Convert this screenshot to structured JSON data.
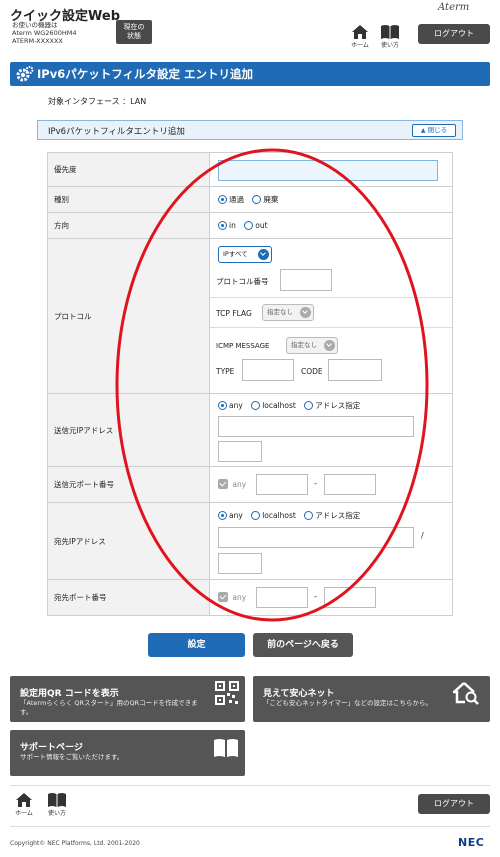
{
  "header": {
    "title": "クイック設定Web",
    "device_lines": [
      "お使いの機器は",
      "Aterm WG2600HM4",
      "ATERM-XXXXXX"
    ],
    "status_btn": [
      "現在の",
      "状態"
    ],
    "home_label": "ホーム",
    "howto_label": "使い方",
    "logout_label": "ログアウト",
    "brand": "Aterm"
  },
  "page_title": "IPv6パケットフィルタ設定 エントリ追加",
  "interface_label": "対象インタフェース ：LAN",
  "section": {
    "title": "IPv6パケットフィルタエントリ追加",
    "close_label": "閉じる"
  },
  "form": {
    "priority": {
      "label": "優先度",
      "value": ""
    },
    "type": {
      "label": "種別",
      "options": [
        "通過",
        "廃棄"
      ],
      "selected": "通過"
    },
    "direction": {
      "label": "方向",
      "options": [
        "in",
        "out"
      ],
      "selected": "in"
    },
    "protocol": {
      "label": "プロトコル",
      "select_value": "IPすべて",
      "number_label": "プロトコル番号",
      "tcp_flag_label": "TCP FLAG",
      "tcp_flag_value": "指定なし",
      "icmp_label": "ICMP MESSAGE",
      "icmp_value": "指定なし",
      "type_label": "TYPE",
      "code_label": "CODE"
    },
    "src_ip": {
      "label": "送信元IPアドレス",
      "options": [
        "any",
        "localhost",
        "アドレス指定"
      ],
      "selected": "any"
    },
    "src_port": {
      "label": "送信元ポート番号",
      "any_label": "any",
      "dash": "-"
    },
    "dst_ip": {
      "label": "宛先IPアドレス",
      "options": [
        "any",
        "localhost",
        "アドレス指定"
      ],
      "selected": "any",
      "slash": "/"
    },
    "dst_port": {
      "label": "宛先ポート番号",
      "any_label": "any",
      "dash": "-"
    }
  },
  "buttons": {
    "submit": "設定",
    "back": "前のページへ戻る"
  },
  "tiles": {
    "qr": {
      "title": "設定用QR コードを表示",
      "desc": [
        "「Atermらくらく QRスタート」用のQRコードを作成できま",
        "す。"
      ]
    },
    "safe": {
      "title": "見えて安心ネット",
      "desc": [
        "「こども安心ネットタイマー」などの設定はこちらから。"
      ]
    },
    "support": {
      "title": "サポートページ",
      "desc": [
        "サポート情報をご覧いただけます。"
      ]
    }
  },
  "footer": {
    "home_label": "ホーム",
    "howto_label": "使い方",
    "logout_label": "ログアウト",
    "copyright": "Copyright© NEC Platforms, Ltd. 2001-2020",
    "nec": "NEC"
  },
  "colors": {
    "accent": "#1f6bb5",
    "dark_button": "#555555",
    "annotation": "#e0141e"
  }
}
